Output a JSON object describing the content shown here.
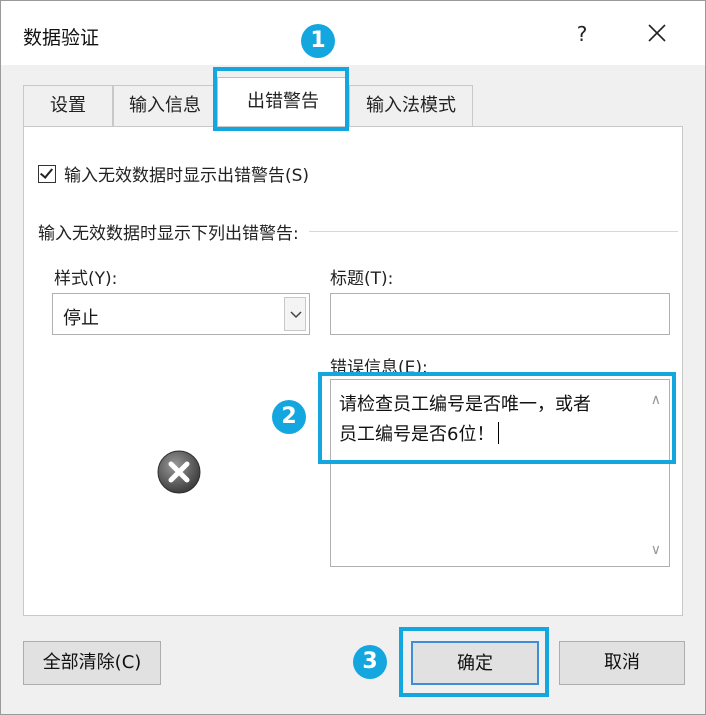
{
  "window": {
    "title": "数据验证",
    "help": "?"
  },
  "tabs": [
    {
      "label": "设置"
    },
    {
      "label": "输入信息"
    },
    {
      "label": "出错警告"
    },
    {
      "label": "输入法模式"
    }
  ],
  "error_alert": {
    "show_checkbox_label": "输入无效数据时显示出错警告(S)",
    "show_checked": true,
    "section_label": "输入无效数据时显示下列出错警告:",
    "style_label": "样式(Y):",
    "style_value": "停止",
    "title_label": "标题(T):",
    "title_value": "",
    "message_label": "错误信息(E):",
    "message_line1": "请检查员工编号是否唯一，或者",
    "message_line2": "员工编号是否6位！",
    "style_icon": "stop-error-icon"
  },
  "buttons": {
    "clear_all": "全部清除(C)",
    "ok": "确定",
    "cancel": "取消"
  },
  "annotations": {
    "badge1": "1",
    "badge2": "2",
    "badge3": "3",
    "color": "#14a7df"
  }
}
